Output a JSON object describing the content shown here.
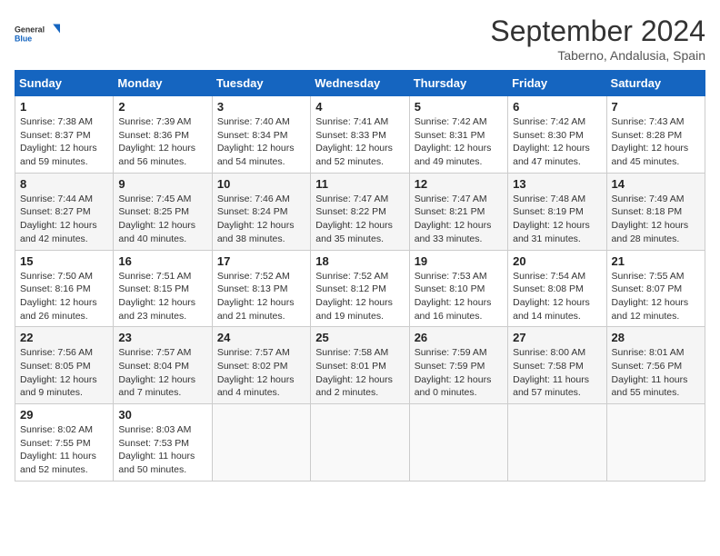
{
  "header": {
    "logo_general": "General",
    "logo_blue": "Blue",
    "month": "September 2024",
    "location": "Taberno, Andalusia, Spain"
  },
  "weekdays": [
    "Sunday",
    "Monday",
    "Tuesday",
    "Wednesday",
    "Thursday",
    "Friday",
    "Saturday"
  ],
  "weeks": [
    [
      {
        "day": "1",
        "info": "Sunrise: 7:38 AM\nSunset: 8:37 PM\nDaylight: 12 hours\nand 59 minutes."
      },
      {
        "day": "2",
        "info": "Sunrise: 7:39 AM\nSunset: 8:36 PM\nDaylight: 12 hours\nand 56 minutes."
      },
      {
        "day": "3",
        "info": "Sunrise: 7:40 AM\nSunset: 8:34 PM\nDaylight: 12 hours\nand 54 minutes."
      },
      {
        "day": "4",
        "info": "Sunrise: 7:41 AM\nSunset: 8:33 PM\nDaylight: 12 hours\nand 52 minutes."
      },
      {
        "day": "5",
        "info": "Sunrise: 7:42 AM\nSunset: 8:31 PM\nDaylight: 12 hours\nand 49 minutes."
      },
      {
        "day": "6",
        "info": "Sunrise: 7:42 AM\nSunset: 8:30 PM\nDaylight: 12 hours\nand 47 minutes."
      },
      {
        "day": "7",
        "info": "Sunrise: 7:43 AM\nSunset: 8:28 PM\nDaylight: 12 hours\nand 45 minutes."
      }
    ],
    [
      {
        "day": "8",
        "info": "Sunrise: 7:44 AM\nSunset: 8:27 PM\nDaylight: 12 hours\nand 42 minutes."
      },
      {
        "day": "9",
        "info": "Sunrise: 7:45 AM\nSunset: 8:25 PM\nDaylight: 12 hours\nand 40 minutes."
      },
      {
        "day": "10",
        "info": "Sunrise: 7:46 AM\nSunset: 8:24 PM\nDaylight: 12 hours\nand 38 minutes."
      },
      {
        "day": "11",
        "info": "Sunrise: 7:47 AM\nSunset: 8:22 PM\nDaylight: 12 hours\nand 35 minutes."
      },
      {
        "day": "12",
        "info": "Sunrise: 7:47 AM\nSunset: 8:21 PM\nDaylight: 12 hours\nand 33 minutes."
      },
      {
        "day": "13",
        "info": "Sunrise: 7:48 AM\nSunset: 8:19 PM\nDaylight: 12 hours\nand 31 minutes."
      },
      {
        "day": "14",
        "info": "Sunrise: 7:49 AM\nSunset: 8:18 PM\nDaylight: 12 hours\nand 28 minutes."
      }
    ],
    [
      {
        "day": "15",
        "info": "Sunrise: 7:50 AM\nSunset: 8:16 PM\nDaylight: 12 hours\nand 26 minutes."
      },
      {
        "day": "16",
        "info": "Sunrise: 7:51 AM\nSunset: 8:15 PM\nDaylight: 12 hours\nand 23 minutes."
      },
      {
        "day": "17",
        "info": "Sunrise: 7:52 AM\nSunset: 8:13 PM\nDaylight: 12 hours\nand 21 minutes."
      },
      {
        "day": "18",
        "info": "Sunrise: 7:52 AM\nSunset: 8:12 PM\nDaylight: 12 hours\nand 19 minutes."
      },
      {
        "day": "19",
        "info": "Sunrise: 7:53 AM\nSunset: 8:10 PM\nDaylight: 12 hours\nand 16 minutes."
      },
      {
        "day": "20",
        "info": "Sunrise: 7:54 AM\nSunset: 8:08 PM\nDaylight: 12 hours\nand 14 minutes."
      },
      {
        "day": "21",
        "info": "Sunrise: 7:55 AM\nSunset: 8:07 PM\nDaylight: 12 hours\nand 12 minutes."
      }
    ],
    [
      {
        "day": "22",
        "info": "Sunrise: 7:56 AM\nSunset: 8:05 PM\nDaylight: 12 hours\nand 9 minutes."
      },
      {
        "day": "23",
        "info": "Sunrise: 7:57 AM\nSunset: 8:04 PM\nDaylight: 12 hours\nand 7 minutes."
      },
      {
        "day": "24",
        "info": "Sunrise: 7:57 AM\nSunset: 8:02 PM\nDaylight: 12 hours\nand 4 minutes."
      },
      {
        "day": "25",
        "info": "Sunrise: 7:58 AM\nSunset: 8:01 PM\nDaylight: 12 hours\nand 2 minutes."
      },
      {
        "day": "26",
        "info": "Sunrise: 7:59 AM\nSunset: 7:59 PM\nDaylight: 12 hours\nand 0 minutes."
      },
      {
        "day": "27",
        "info": "Sunrise: 8:00 AM\nSunset: 7:58 PM\nDaylight: 11 hours\nand 57 minutes."
      },
      {
        "day": "28",
        "info": "Sunrise: 8:01 AM\nSunset: 7:56 PM\nDaylight: 11 hours\nand 55 minutes."
      }
    ],
    [
      {
        "day": "29",
        "info": "Sunrise: 8:02 AM\nSunset: 7:55 PM\nDaylight: 11 hours\nand 52 minutes."
      },
      {
        "day": "30",
        "info": "Sunrise: 8:03 AM\nSunset: 7:53 PM\nDaylight: 11 hours\nand 50 minutes."
      },
      null,
      null,
      null,
      null,
      null
    ]
  ]
}
